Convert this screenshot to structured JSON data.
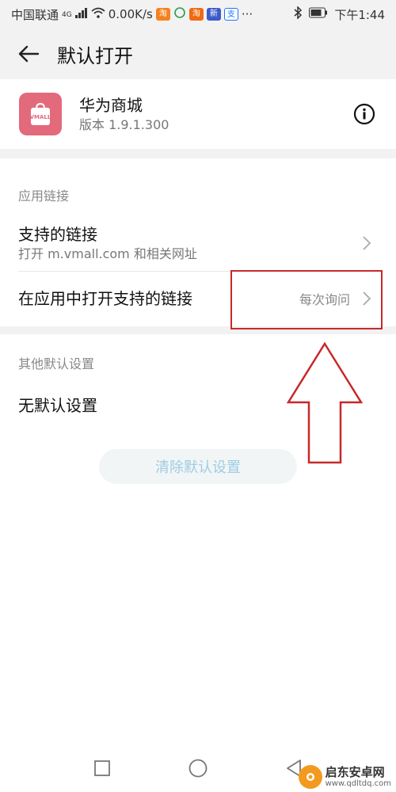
{
  "status_bar": {
    "carrier": "中国联通",
    "network": "4G",
    "speed": "0.00K/s",
    "time": "下午1:44",
    "icons": [
      "signal-icon",
      "wifi-icon",
      "taobao-app-icon",
      "chat-icon",
      "shopping-app-icon",
      "news-app-icon",
      "alipay-app-icon",
      "more-dots-icon",
      "bluetooth-icon",
      "battery-icon"
    ]
  },
  "header": {
    "title": "默认打开",
    "back_icon": "back-arrow-icon"
  },
  "app": {
    "name": "华为商城",
    "version": "版本 1.9.1.300",
    "icon_text": "VMALL",
    "icon_color": "#e36a7b"
  },
  "app_links": {
    "section_title": "应用链接",
    "supported_links": {
      "title": "支持的链接",
      "subtitle": "打开 m.vmall.com 和相关网址"
    },
    "open_in_app": {
      "title": "在应用中打开支持的链接",
      "value": "每次询问"
    }
  },
  "other_defaults": {
    "section_title": "其他默认设置",
    "status": "无默认设置",
    "clear_button": "清除默认设置"
  },
  "annotation": {
    "color": "#c8282a"
  },
  "nav_bar": {
    "icons": [
      "recents-square-icon",
      "home-circle-icon",
      "back-triangle-icon"
    ]
  },
  "watermark": {
    "name": "启东安卓网",
    "url": "www.qdltdq.com"
  },
  "colors": {
    "accent": "#9fcce3",
    "background": "#f2f2f2"
  }
}
